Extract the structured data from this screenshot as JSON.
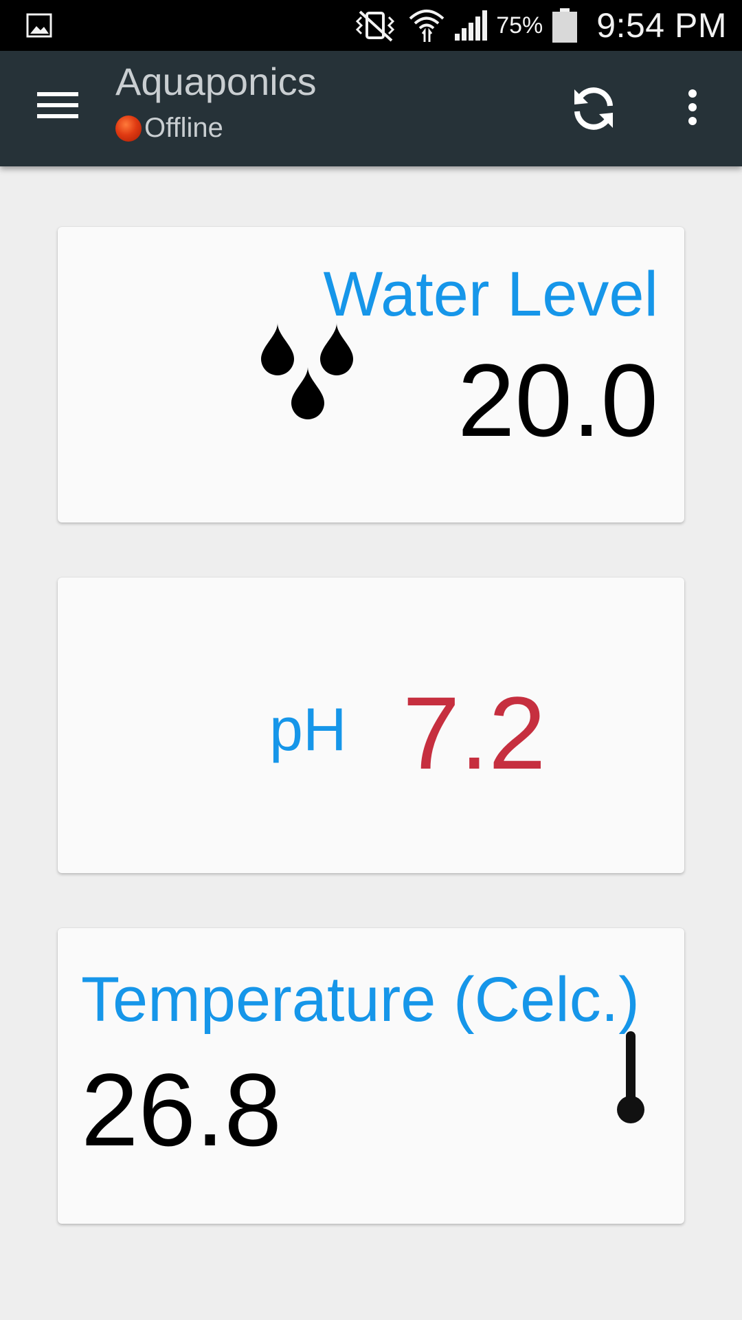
{
  "status_bar": {
    "battery_percent": "75%",
    "time": "9:54 PM",
    "icons": [
      "gallery-icon",
      "vibrate-mute-icon",
      "wifi-icon",
      "signal-icon",
      "battery-icon"
    ]
  },
  "app_bar": {
    "title": "Aquaponics",
    "connection_status": "Offline",
    "status_color": "#e03a12",
    "background_color": "#263238"
  },
  "cards": {
    "water_level": {
      "label": "Water Level",
      "value": "20.0",
      "icon": "water-drops-icon"
    },
    "ph": {
      "label": "pH",
      "value": "7.2",
      "value_color": "#c62f3f"
    },
    "temperature": {
      "label": "Temperature (Celc.)",
      "value": "26.8",
      "icon": "thermometer-icon"
    }
  },
  "accent_color": "#1696e9"
}
